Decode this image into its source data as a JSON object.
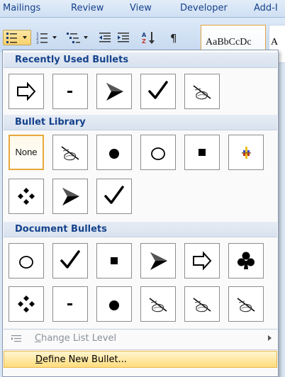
{
  "ribbon_tabs": [
    "Mailings",
    "Review",
    "View",
    "Developer",
    "Add-I"
  ],
  "style_gallery": {
    "sample_text": "AaBbCcDc",
    "sample_text_2": "A"
  },
  "menu": {
    "sections": {
      "recent": "Recently Used Bullets",
      "library": "Bullet Library",
      "document": "Document Bullets"
    },
    "none_label": "None",
    "recent_bullets": [
      "outline-arrow",
      "dash",
      "arrowhead",
      "checkmark",
      "shadow-bullet"
    ],
    "library_bullets": [
      "none",
      "shadow-bullet",
      "filled-circle",
      "hollow-circle",
      "filled-square",
      "color-picture",
      "four-diamonds",
      "arrowhead",
      "checkmark"
    ],
    "document_bullets": [
      "hollow-circle",
      "checkmark",
      "filled-square",
      "arrowhead",
      "outline-arrow",
      "club",
      "four-diamonds",
      "dash",
      "filled-circle",
      "shadow-bullet",
      "shadow-bullet",
      "shadow-bullet"
    ],
    "change_list_level": {
      "first": "C",
      "rest": "hange List Level"
    },
    "define_new_bullet": {
      "first": "D",
      "rest": "efine New Bullet..."
    }
  },
  "colors": {
    "header_text": "#15428b",
    "highlight": "#ffdd7e",
    "selected_border": "#e8a83a"
  }
}
